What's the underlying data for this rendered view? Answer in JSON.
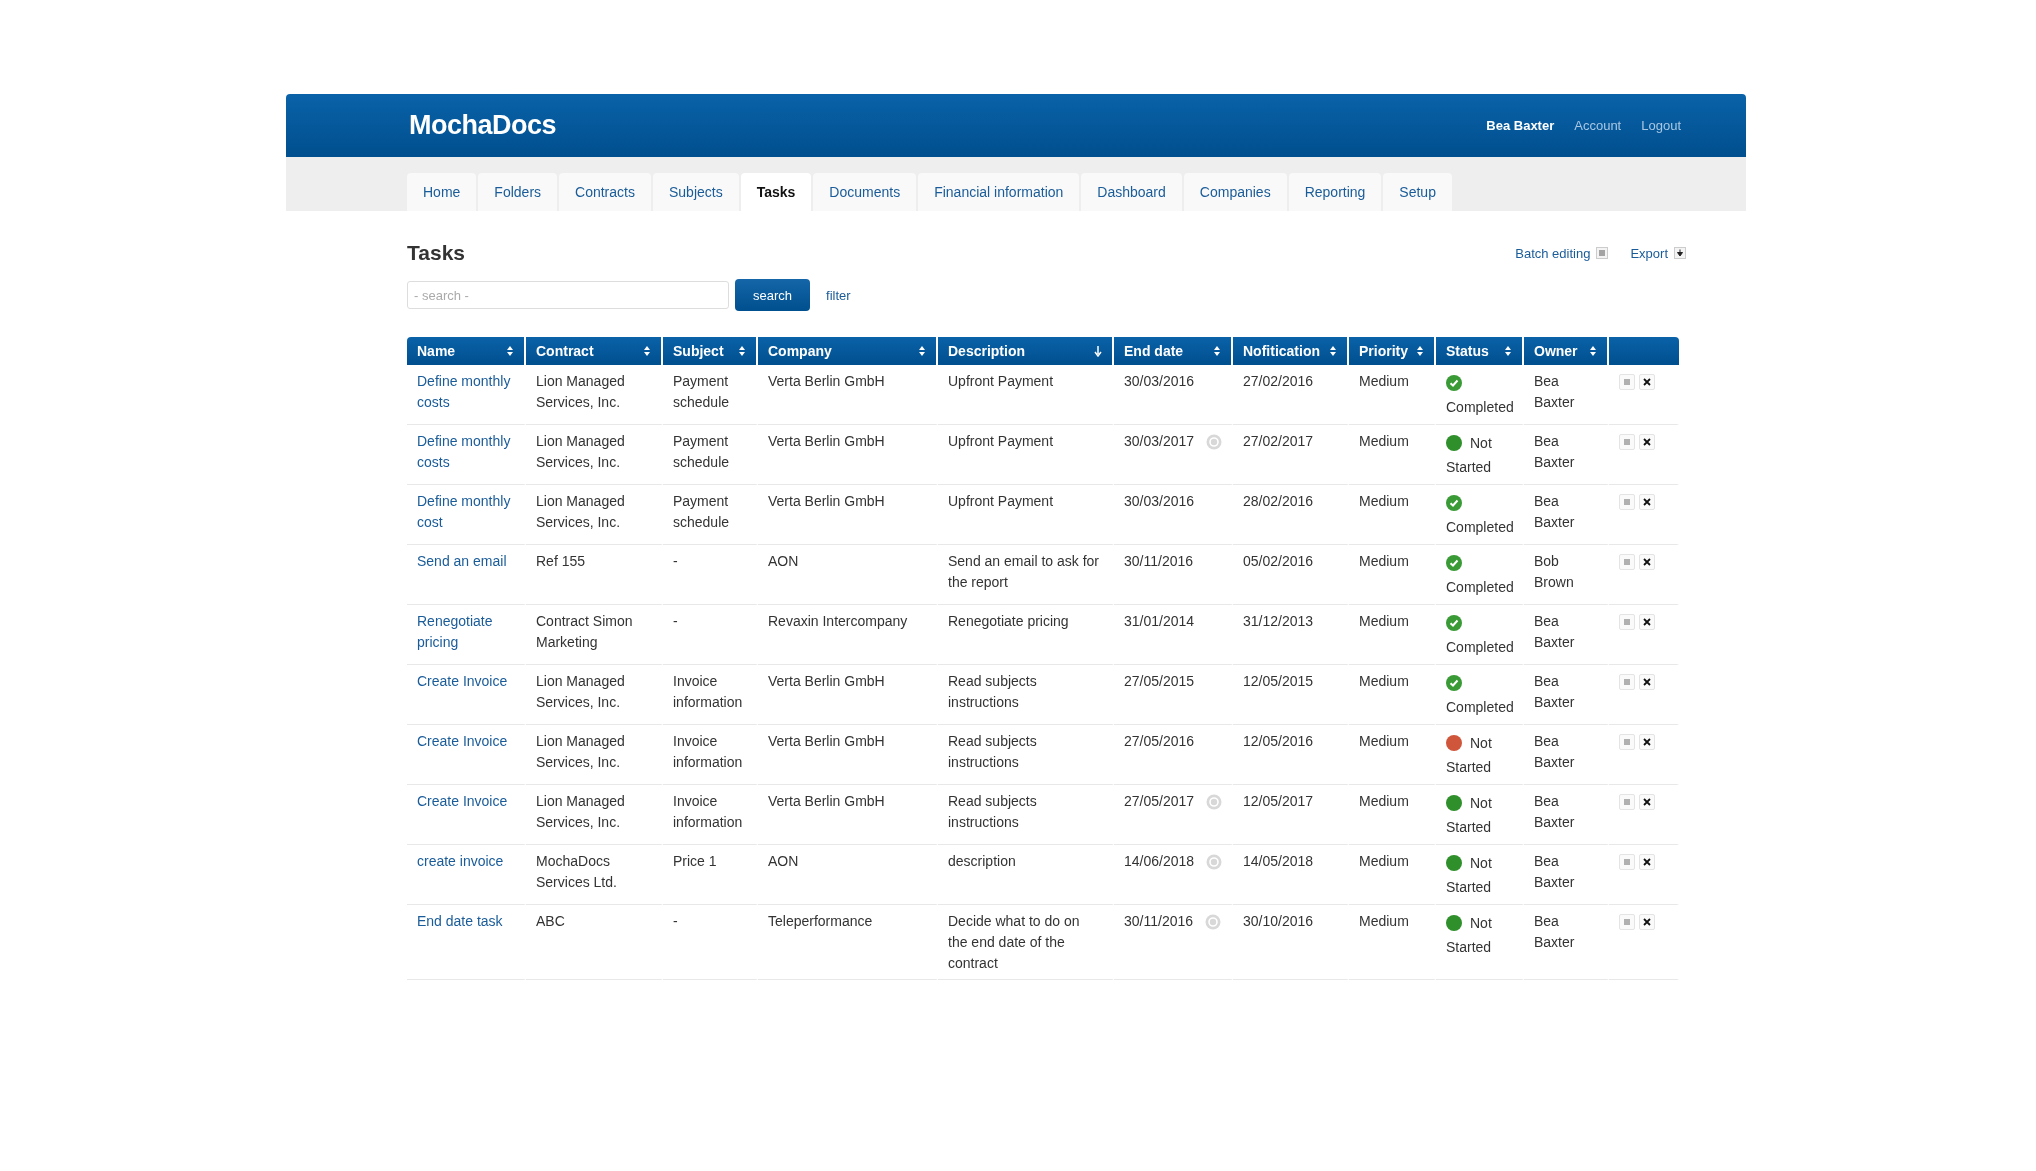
{
  "header": {
    "logo": "MochaDocs",
    "user": "Bea Baxter",
    "links": [
      "Account",
      "Logout"
    ]
  },
  "nav": [
    {
      "label": "Home",
      "selected": false
    },
    {
      "label": "Folders",
      "selected": false
    },
    {
      "label": "Contracts",
      "selected": false
    },
    {
      "label": "Subjects",
      "selected": false
    },
    {
      "label": "Tasks",
      "selected": true
    },
    {
      "label": "Documents",
      "selected": false
    },
    {
      "label": "Financial information",
      "selected": false
    },
    {
      "label": "Dashboard",
      "selected": false
    },
    {
      "label": "Companies",
      "selected": false
    },
    {
      "label": "Reporting",
      "selected": false
    },
    {
      "label": "Setup",
      "selected": false
    }
  ],
  "page_title": "Tasks",
  "actions": [
    {
      "label": "Batch editing",
      "kind": "list"
    },
    {
      "label": "Export",
      "kind": "download"
    }
  ],
  "search": {
    "placeholder": "- search -",
    "button": "search",
    "filter": "filter"
  },
  "table": {
    "columns": [
      {
        "label": "Name",
        "sorted": false
      },
      {
        "label": "Contract",
        "sorted": false
      },
      {
        "label": "Subject",
        "sorted": false
      },
      {
        "label": "Company",
        "sorted": false
      },
      {
        "label": "Description",
        "sorted": true
      },
      {
        "label": "End date",
        "sorted": false
      },
      {
        "label": "Nofitication",
        "sorted": false
      },
      {
        "label": "Priority",
        "sorted": false
      },
      {
        "label": "Status",
        "sorted": false
      },
      {
        "label": "Owner",
        "sorted": false
      }
    ],
    "rows": [
      {
        "name": "Define monthly costs",
        "contract": "Lion Managed Services, Inc.",
        "subject": "Payment schedule",
        "company": "Verta Berlin GmbH",
        "description": "Upfront Payment",
        "end_date": "30/03/2016",
        "reminder": false,
        "notification": "27/02/2016",
        "priority": "Medium",
        "status": {
          "label": "Completed",
          "kind": "check",
          "color": "#3a9a35"
        },
        "owner": "Bea Baxter"
      },
      {
        "name": "Define monthly costs",
        "contract": "Lion Managed Services, Inc.",
        "subject": "Payment schedule",
        "company": "Verta Berlin GmbH",
        "description": "Upfront Payment",
        "end_date": "30/03/2017",
        "reminder": true,
        "notification": "27/02/2017",
        "priority": "Medium",
        "status": {
          "label": "Not Started",
          "kind": "dot",
          "color": "#2f8f2a"
        },
        "owner": "Bea Baxter"
      },
      {
        "name": "Define monthly cost",
        "contract": "Lion Managed Services, Inc.",
        "subject": "Payment schedule",
        "company": "Verta Berlin GmbH",
        "description": "Upfront Payment",
        "end_date": "30/03/2016",
        "reminder": false,
        "notification": "28/02/2016",
        "priority": "Medium",
        "status": {
          "label": "Completed",
          "kind": "check",
          "color": "#3a9a35"
        },
        "owner": "Bea Baxter"
      },
      {
        "name": "Send an email",
        "contract": "Ref 155",
        "subject": "-",
        "company": "AON",
        "description": "Send an email to ask for the report",
        "end_date": "30/11/2016",
        "reminder": false,
        "notification": "05/02/2016",
        "priority": "Medium",
        "status": {
          "label": "Completed",
          "kind": "check",
          "color": "#3a9a35"
        },
        "owner": "Bob Brown"
      },
      {
        "name": "Renegotiate pricing",
        "contract": "Contract Simon Marketing",
        "subject": "-",
        "company": "Revaxin Intercompany",
        "description": "Renegotiate pricing",
        "end_date": "31/01/2014",
        "reminder": false,
        "notification": "31/12/2013",
        "priority": "Medium",
        "status": {
          "label": "Completed",
          "kind": "check",
          "color": "#3a9a35"
        },
        "owner": "Bea Baxter"
      },
      {
        "name": "Create Invoice",
        "contract": "Lion Managed Services, Inc.",
        "subject": "Invoice information",
        "company": "Verta Berlin GmbH",
        "description": "Read subjects instructions",
        "end_date": "27/05/2015",
        "reminder": false,
        "notification": "12/05/2015",
        "priority": "Medium",
        "status": {
          "label": "Completed",
          "kind": "check",
          "color": "#3a9a35"
        },
        "owner": "Bea Baxter"
      },
      {
        "name": "Create Invoice",
        "contract": "Lion Managed Services, Inc.",
        "subject": "Invoice information",
        "company": "Verta Berlin GmbH",
        "description": "Read subjects instructions",
        "end_date": "27/05/2016",
        "reminder": false,
        "notification": "12/05/2016",
        "priority": "Medium",
        "status": {
          "label": "Not Started",
          "kind": "dot",
          "color": "#d0563b"
        },
        "owner": "Bea Baxter"
      },
      {
        "name": "Create Invoice",
        "contract": "Lion Managed Services, Inc.",
        "subject": "Invoice information",
        "company": "Verta Berlin GmbH",
        "description": "Read subjects instructions",
        "end_date": "27/05/2017",
        "reminder": true,
        "notification": "12/05/2017",
        "priority": "Medium",
        "status": {
          "label": "Not Started",
          "kind": "dot",
          "color": "#2f8f2a"
        },
        "owner": "Bea Baxter"
      },
      {
        "name": "create invoice",
        "contract": "MochaDocs Services Ltd.",
        "subject": "Price 1",
        "company": "AON",
        "description": "description",
        "end_date": "14/06/2018",
        "reminder": true,
        "notification": "14/05/2018",
        "priority": "Medium",
        "status": {
          "label": "Not Started",
          "kind": "dot",
          "color": "#2f8f2a"
        },
        "owner": "Bea Baxter"
      },
      {
        "name": "End date task",
        "contract": "ABC",
        "subject": "-",
        "company": "Teleperformance",
        "description": "Decide what to do on the end date of the contract",
        "end_date": "30/11/2016",
        "reminder": true,
        "notification": "30/10/2016",
        "priority": "Medium",
        "status": {
          "label": "Not Started",
          "kind": "dot",
          "color": "#2f8f2a"
        },
        "owner": "Bea Baxter"
      }
    ]
  }
}
